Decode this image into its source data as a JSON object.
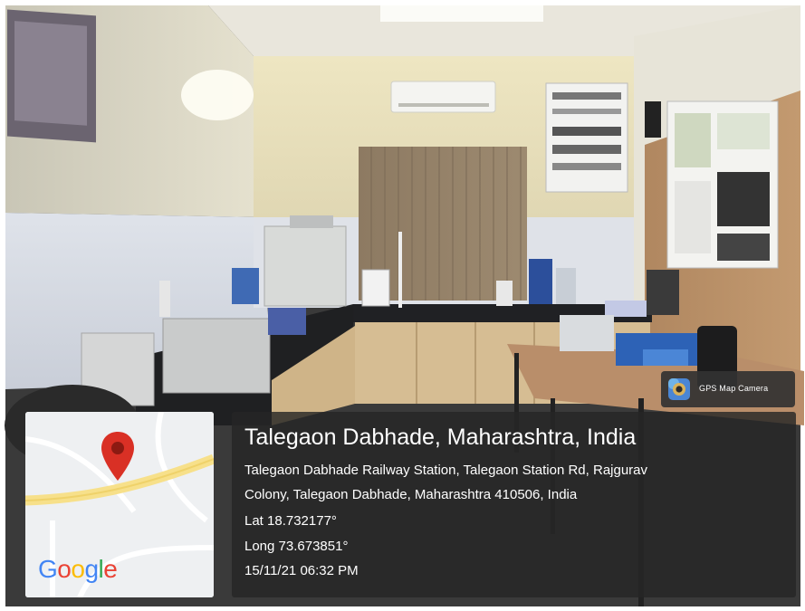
{
  "badge": {
    "label": "GPS Map Camera",
    "icon": "camera-lens-icon"
  },
  "map": {
    "logo_text": "Google",
    "logo_letters": [
      "G",
      "o",
      "o",
      "g",
      "l",
      "e"
    ],
    "logo_colors": [
      "#4285f4",
      "#ea4335",
      "#fbbc05",
      "#4285f4",
      "#34a853",
      "#ea4335"
    ],
    "pin_color": "#d93025",
    "road_color": "#f7e08a"
  },
  "location": {
    "title": "Talegaon Dabhade, Maharashtra, India",
    "address_line1": "Talegaon Dabhade Railway Station, Talegaon Station Rd, Rajgurav",
    "address_line2": "Colony, Talegaon Dabhade, Maharashtra 410506, India",
    "lat": "Lat 18.732177°",
    "long": "Long 73.673851°",
    "datetime": "15/11/21 06:32 PM"
  }
}
